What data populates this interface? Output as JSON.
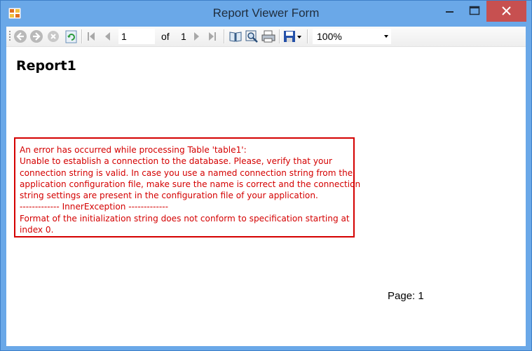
{
  "window": {
    "title": "Report Viewer Form"
  },
  "toolbar": {
    "back_icon": "back-icon",
    "forward_icon": "forward-icon",
    "stop_icon": "stop-icon",
    "refresh_icon": "refresh-icon",
    "current_page": "1",
    "of_label": "of",
    "total_pages": "1",
    "zoom_value": "100%"
  },
  "report": {
    "title": "Report1",
    "error_lines": [
      "An error has occurred while processing Table 'table1':",
      "Unable to establish a connection to the database. Please, verify that your",
      "connection string is valid. In case you use a named connection string from the",
      "application configuration file, make sure the name is correct and the connection",
      "string settings are present in the configuration file of your application.",
      "------------- InnerException -------------",
      "Format of the initialization string does not conform to specification starting at",
      "index 0."
    ],
    "footer": "Page: 1"
  },
  "colors": {
    "window_frame": "#6aa8e8",
    "close_button": "#c75050",
    "error_red": "#d40000"
  }
}
